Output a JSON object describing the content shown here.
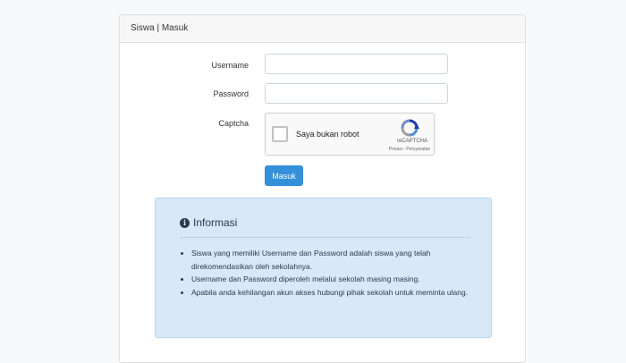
{
  "card": {
    "header": "Siswa | Masuk"
  },
  "form": {
    "username_label": "Username",
    "username_value": "",
    "password_label": "Password",
    "password_value": "",
    "captcha_label": "Captcha",
    "captcha": {
      "checkbox_text": "Saya bukan robot",
      "brand": "reCAPTCHA",
      "links": "Privasi - Persyaratan",
      "logo_icon": "recaptcha-logo-icon"
    },
    "submit_label": "Masuk"
  },
  "info": {
    "icon": "info-icon",
    "icon_glyph": "i",
    "title": "Informasi",
    "items": [
      "Siswa yang memiliki Username dan Password adalah siswa yang telah direkomendasikan oleh sekolahnya.",
      "Username dan Password diperoleh melalui sekolah masing masing.",
      "Apabila anda kehilangan akun akses hubungi pihak sekolah untuk meminta ulang."
    ]
  },
  "colors": {
    "primary_button": "#3390d9",
    "info_background": "#d8e8f6"
  }
}
